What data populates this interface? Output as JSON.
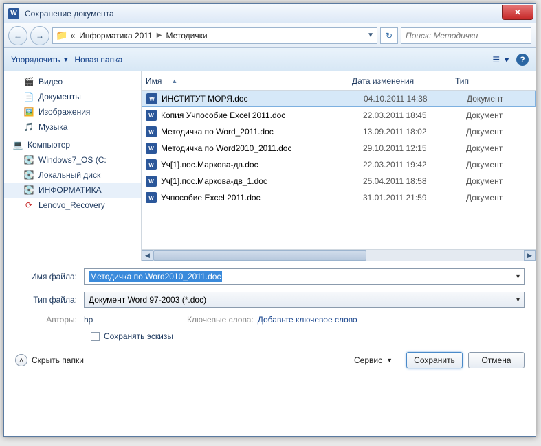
{
  "window": {
    "title": "Сохранение документа"
  },
  "nav": {
    "crumb1": "Информатика 2011",
    "crumb2": "Методички",
    "search_placeholder": "Поиск: Методички"
  },
  "toolbar": {
    "organize": "Упорядочить",
    "newfolder": "Новая папка"
  },
  "sidebar": {
    "items": [
      {
        "label": "Видео"
      },
      {
        "label": "Документы"
      },
      {
        "label": "Изображения"
      },
      {
        "label": "Музыка"
      }
    ],
    "computer_label": "Компьютер",
    "drives": [
      {
        "label": "Windows7_OS (C:"
      },
      {
        "label": "Локальный диск"
      },
      {
        "label": "ИНФОРМАТИКА"
      },
      {
        "label": "Lenovo_Recovery"
      }
    ]
  },
  "columns": {
    "name": "Имя",
    "date": "Дата изменения",
    "type": "Тип"
  },
  "files": [
    {
      "name": "ИНСТИТУТ МОРЯ.doc",
      "date": "04.10.2011 14:38",
      "type": "Документ"
    },
    {
      "name": "Копия Учпособие Excel 2011.doc",
      "date": "22.03.2011 18:45",
      "type": "Документ"
    },
    {
      "name": "Методичка по Word_2011.doc",
      "date": "13.09.2011 18:02",
      "type": "Документ"
    },
    {
      "name": "Методичка по Word2010_2011.doc",
      "date": "29.10.2011 12:15",
      "type": "Документ"
    },
    {
      "name": "Уч[1].пос.Маркова-дв.doc",
      "date": "22.03.2011 19:42",
      "type": "Документ"
    },
    {
      "name": "Уч[1].пос.Маркова-дв_1.doc",
      "date": "25.04.2011 18:58",
      "type": "Документ"
    },
    {
      "name": "Учпособие Excel 2011.doc",
      "date": "31.01.2011 21:59",
      "type": "Документ"
    }
  ],
  "form": {
    "filename_label": "Имя файла:",
    "filename_value": "Методичка по Word2010_2011.doc",
    "filetype_label": "Тип файла:",
    "filetype_value": "Документ Word 97-2003 (*.doc)",
    "authors_label": "Авторы:",
    "authors_value": "hp",
    "keywords_label": "Ключевые слова:",
    "keywords_value": "Добавьте ключевое слово",
    "save_thumb": "Сохранять эскизы"
  },
  "footer": {
    "hide_folders": "Скрыть папки",
    "service": "Сервис",
    "save": "Сохранить",
    "cancel": "Отмена"
  }
}
